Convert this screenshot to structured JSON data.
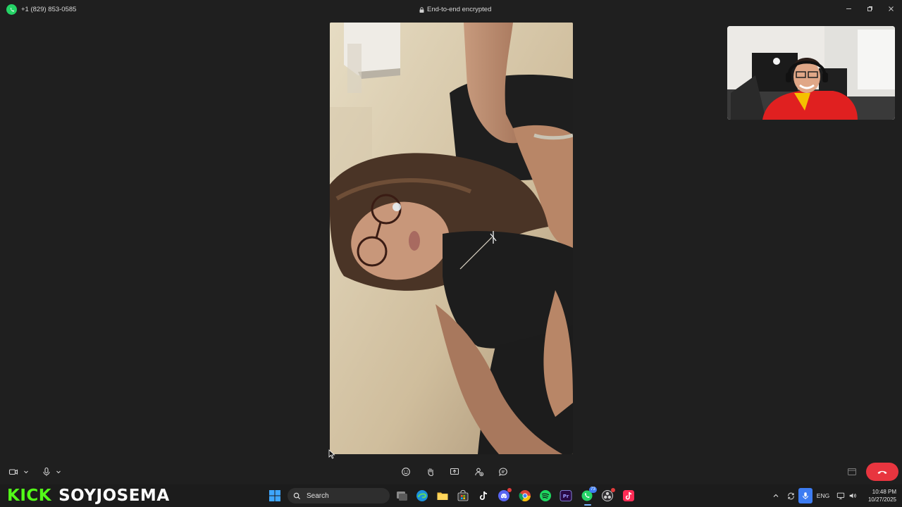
{
  "window": {
    "contact_number": "+1 (829) 853-0585",
    "encryption_status": "End-to-end encrypted",
    "controls": [
      "minimize-icon",
      "maximize-icon",
      "close-icon"
    ]
  },
  "call": {
    "remote_video": "remote-participant-video",
    "self_video": "self-view-video",
    "controls_left": [
      "video-camera-icon",
      "chevron-down-icon",
      "microphone-icon",
      "chevron-down-icon"
    ],
    "controls_center": [
      "emoji-icon",
      "raise-hand-icon",
      "share-screen-icon",
      "add-participant-icon",
      "chat-icon"
    ],
    "controls_right": [
      "layout-icon",
      "end-call-icon"
    ],
    "end_call_color": "#e8353f"
  },
  "overlay": {
    "brand": "KICK",
    "channel": "SOYJOSEMA",
    "brand_color": "#53fc18"
  },
  "taskbar": {
    "search_placeholder": "Search",
    "apps": [
      "windows-start-icon",
      "task-view-icon",
      "edge-icon",
      "file-explorer-icon",
      "microsoft-store-icon",
      "tiktok-icon",
      "discord-icon",
      "chrome-icon",
      "spotify-icon",
      "premiere-pro-icon",
      "whatsapp-icon",
      "obs-icon",
      "capcut-icon"
    ],
    "discord_badge": "",
    "whatsapp_badge": "73",
    "tray": {
      "language": "ENG",
      "time": "10:48 PM",
      "date": "10/27/2025"
    }
  }
}
